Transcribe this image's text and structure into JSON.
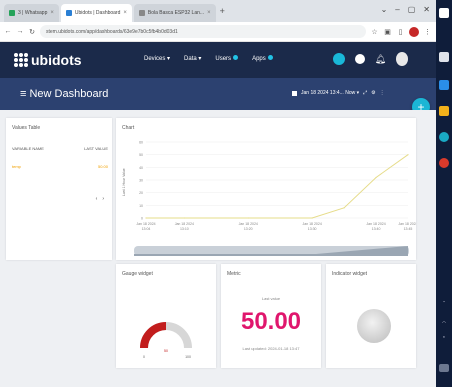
{
  "browser": {
    "tabs": [
      {
        "label": "3 | Whatsapp",
        "active": false
      },
      {
        "label": "Ubidots | Dashboard",
        "active": true
      },
      {
        "label": "Bola Basca ESP32 Lan...",
        "active": false
      }
    ],
    "url": "stem.ubidots.com/app/dashboards/63e9e7b0c5fb4b0d03d1"
  },
  "app": {
    "logo_text": "ubidots",
    "menu": [
      {
        "label": "Devices ▾"
      },
      {
        "label": "Data ▾"
      },
      {
        "label": "Users",
        "badge": true
      },
      {
        "label": "Apps",
        "badge": true
      }
    ],
    "dashboard_title": "≡ New Dashboard",
    "date_range": "Jan 18 2024 13:4... Now ▾",
    "fab": "+"
  },
  "widgets": {
    "values_table": {
      "title": "Values Table",
      "col_variable": "VARIABLE NAME",
      "col_value": "LAST VALUE",
      "row_name": "temp",
      "row_value": "50.00",
      "pager": [
        "‹",
        "›"
      ]
    },
    "chart": {
      "title": "Chart",
      "ylabel": "Last 1 Hour Value"
    },
    "gauge": {
      "title": "Gauge widget",
      "min_label": "0",
      "value_label": "50",
      "max_label": "100",
      "color": "#c21d1d"
    },
    "metric": {
      "title": "Metric",
      "label": "Last value",
      "value": "50.00",
      "footer": "Last updated: 2024-01-18 13:47"
    },
    "indicator": {
      "title": "Indicator widget"
    }
  },
  "chart_data": {
    "type": "line",
    "x": [
      "Jan 18 2024 13:04",
      "Jan 18 2024 13:10",
      "Jan 18 2024 13:20",
      "Jan 18 2024 13:30",
      "Jan 18 2024 13:35",
      "Jan 18 2024 13:40",
      "Jan 18 2024 13:45"
    ],
    "x_tick_labels": [
      [
        "Jan 18 2024",
        "13:04"
      ],
      [
        "Jan 18 2024",
        "13:10"
      ],
      [
        "Jan 18 2024",
        "13:20"
      ],
      [
        "Jan 18 2024",
        "13:30"
      ],
      [
        "Jan 18 2024",
        "13:40"
      ],
      [
        "Jan 18 2024",
        "13:45"
      ]
    ],
    "series": [
      {
        "values": [
          0,
          0,
          0,
          0,
          8,
          32,
          50
        ],
        "color": "#e6dc8a"
      }
    ],
    "y_ticks": [
      0,
      10,
      20,
      30,
      40,
      50,
      60
    ],
    "ylim": [
      0,
      60
    ],
    "grid": true,
    "title": "Chart",
    "ylabel": "Last 1 Hour Value"
  }
}
